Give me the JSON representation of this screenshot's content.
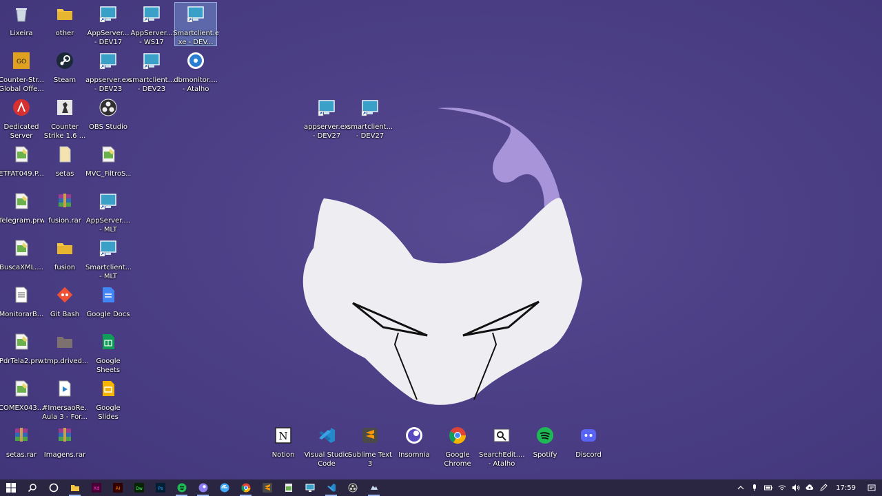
{
  "desktop": {
    "icons": [
      {
        "label": "Lixeira",
        "icon": "recycle-bin-icon",
        "color": "#cfd8e3"
      },
      {
        "label": "other",
        "icon": "folder-icon",
        "color": "#f5c542"
      },
      {
        "label": "AppServer...\n- DEV17",
        "icon": "remote-app-icon",
        "color": "#3aa0c8"
      },
      {
        "label": "AppServer...\n- WS17",
        "icon": "remote-app-icon",
        "color": "#3aa0c8"
      },
      {
        "label": "Smartclient.e\nxe - DEV...",
        "icon": "remote-app-icon",
        "color": "#3aa0c8"
      },
      {
        "label": "Counter-Str...\nGlobal Offe...",
        "icon": "csgo-icon",
        "color": "#e0a020"
      },
      {
        "label": "Steam",
        "icon": "steam-icon",
        "color": "#1b2838"
      },
      {
        "label": "appserver.exe\n- DEV23",
        "icon": "remote-app-icon",
        "color": "#3aa0c8"
      },
      {
        "label": "smartclient....\n- DEV23",
        "icon": "remote-app-icon",
        "color": "#3aa0c8"
      },
      {
        "label": "dbmonitor....\n- Atalho",
        "icon": "dbmonitor-icon",
        "color": "#2b7fd0"
      },
      {
        "label": "Dedicated\nServer",
        "icon": "dedicated-server-icon",
        "color": "#d63030"
      },
      {
        "label": "Counter\nStrike 1.6 ...",
        "icon": "counter-strike-icon",
        "color": "#e6e6e6"
      },
      {
        "label": "OBS Studio",
        "icon": "obs-icon",
        "color": "#302e31"
      },
      {
        "label": "ETFAT049.P...",
        "icon": "prw-file-icon",
        "color": "#6ab04c"
      },
      {
        "label": "setas",
        "icon": "file-icon",
        "color": "#f3e3b0"
      },
      {
        "label": "MVC_FiltroS...",
        "icon": "prw-file-icon",
        "color": "#6ab04c"
      },
      {
        "label": "Telegram.prw",
        "icon": "prw-file-icon",
        "color": "#6ab04c"
      },
      {
        "label": "fusion.rar",
        "icon": "rar-icon",
        "color": "#a03a8c"
      },
      {
        "label": "AppServer....\n- MLT",
        "icon": "remote-app-icon",
        "color": "#3aa0c8"
      },
      {
        "label": "BuscaXML....",
        "icon": "prw-file-icon",
        "color": "#6ab04c"
      },
      {
        "label": "fusion",
        "icon": "folder-icon",
        "color": "#f5c542"
      },
      {
        "label": "Smartclient....\n- MLT",
        "icon": "remote-app-icon",
        "color": "#3aa0c8"
      },
      {
        "label": "MonitorarB...",
        "icon": "text-document-icon",
        "color": "#ffffff"
      },
      {
        "label": "Git Bash",
        "icon": "git-bash-icon",
        "color": "#f05033"
      },
      {
        "label": "Google Docs",
        "icon": "google-docs-icon",
        "color": "#4285f4"
      },
      {
        "label": "PdrTela2.prw",
        "icon": "prw-file-icon",
        "color": "#6ab04c"
      },
      {
        "label": ".tmp.drived...",
        "icon": "folder-hidden-icon",
        "color": "#8a7f6a"
      },
      {
        "label": "Google\nSheets",
        "icon": "google-sheets-icon",
        "color": "#0f9d58"
      },
      {
        "label": "COMEX043....",
        "icon": "prw-file-icon",
        "color": "#6ab04c"
      },
      {
        "label": "#ImersaoRe...\nAula 3 - For...",
        "icon": "video-file-icon",
        "color": "#ffffff"
      },
      {
        "label": "Google\nSlides",
        "icon": "google-slides-icon",
        "color": "#f4b400"
      },
      {
        "label": "setas.rar",
        "icon": "rar-icon",
        "color": "#a03a8c"
      },
      {
        "label": "Imagens.rar",
        "icon": "rar-icon",
        "color": "#a03a8c"
      },
      {
        "label": "appserver.exe\n- DEV27",
        "icon": "remote-app-icon",
        "color": "#3aa0c8"
      },
      {
        "label": "smartclient....\n- DEV27",
        "icon": "remote-app-icon",
        "color": "#3aa0c8"
      },
      {
        "label": "Notion",
        "icon": "notion-icon",
        "color": "#ffffff"
      },
      {
        "label": "Visual Studio\nCode",
        "icon": "vscode-icon",
        "color": "#2489ca"
      },
      {
        "label": "Sublime Text\n3",
        "icon": "sublime-icon",
        "color": "#ff9800"
      },
      {
        "label": "Insomnia",
        "icon": "insomnia-icon",
        "color": "#5849be"
      },
      {
        "label": "Google\nChrome",
        "icon": "chrome-icon",
        "color": "#db4437"
      },
      {
        "label": "SearchEdit....\n- Atalho",
        "icon": "search-edit-icon",
        "color": "#ffffff"
      },
      {
        "label": "Spotify",
        "icon": "spotify-icon",
        "color": "#1db954"
      },
      {
        "label": "Discord",
        "icon": "discord-icon",
        "color": "#5865f2"
      }
    ]
  },
  "taskbar": {
    "start": "windows-start-icon",
    "apps": [
      {
        "icon": "search-icon",
        "color": "#ffffff"
      },
      {
        "icon": "cortana-icon",
        "color": "#ffffff"
      },
      {
        "icon": "file-explorer-icon",
        "color": "#f5c542"
      },
      {
        "icon": "xd-icon",
        "color": "#ff2bc2"
      },
      {
        "icon": "illustrator-icon",
        "color": "#ff7c00"
      },
      {
        "icon": "dreamweaver-icon",
        "color": "#4aff7a"
      },
      {
        "icon": "photoshop-icon",
        "color": "#31a8ff"
      },
      {
        "icon": "spotify-icon",
        "color": "#1db954"
      },
      {
        "icon": "insomnia-icon",
        "color": "#8b7cf0"
      },
      {
        "icon": "edge-icon",
        "color": "#3fa9f5"
      },
      {
        "icon": "chrome-icon",
        "color": "#db4437"
      },
      {
        "icon": "sublime-icon",
        "color": "#ff9800"
      },
      {
        "icon": "notepad-icon",
        "color": "#6ab04c"
      },
      {
        "icon": "remote-app-icon",
        "color": "#3aa0c8"
      },
      {
        "icon": "vscode-icon",
        "color": "#2489ca"
      },
      {
        "icon": "obs-icon",
        "color": "#d0d0d0"
      },
      {
        "icon": "app-icon",
        "color": "#c8d8f0"
      }
    ],
    "tray": [
      "chevron-up-icon",
      "microphone-icon",
      "battery-icon",
      "wifi-icon",
      "volume-icon",
      "cloud-icon",
      "pen-icon"
    ],
    "clock": "17:59",
    "notification": "notification-icon"
  },
  "colors": {
    "wallpaper": "#4c3f86",
    "taskbar": "#2a2540",
    "character_face": "#eeeef2",
    "character_horn": "#a894d8"
  }
}
